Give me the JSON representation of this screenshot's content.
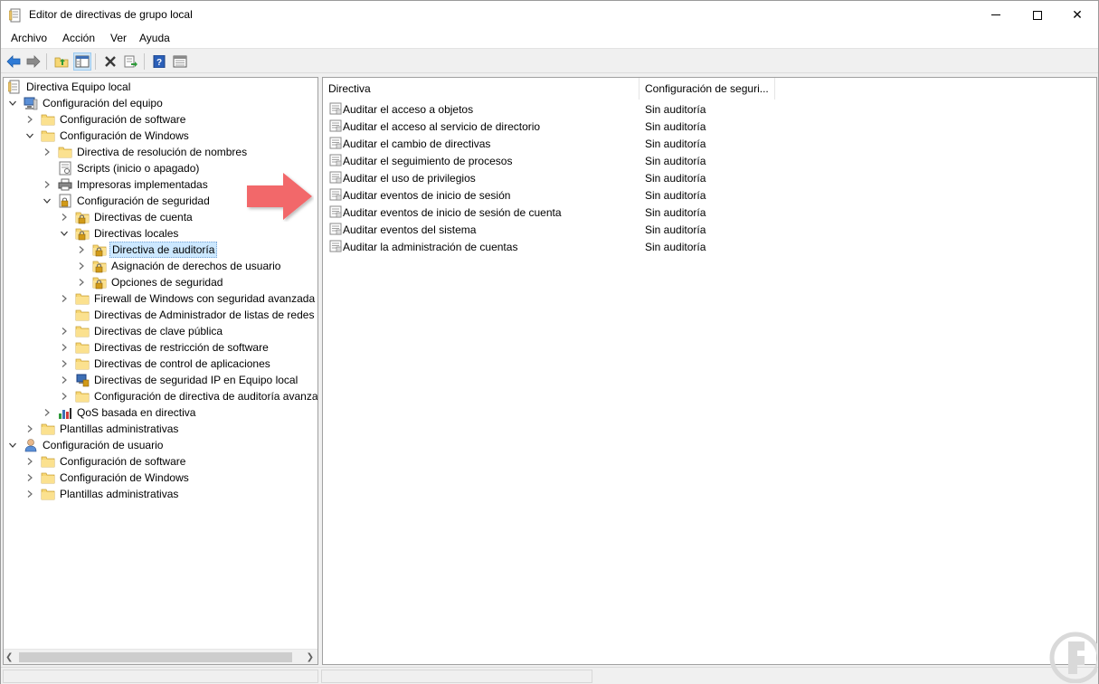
{
  "window": {
    "title": "Editor de directivas de grupo local",
    "minimize_glyph": "",
    "maximize_glyph": "",
    "close_glyph": "✕"
  },
  "menu": [
    "Archivo",
    "Acción",
    "Ver",
    "Ayuda"
  ],
  "tree": [
    {
      "label": "Directiva Equipo local",
      "level": 0,
      "expander": "none",
      "icon": "policy-doc-icon"
    },
    {
      "label": "Configuración del equipo",
      "level": 0,
      "expander": "open",
      "icon": "computer-icon"
    },
    {
      "label": "Configuración de software",
      "level": 1,
      "expander": "closed",
      "icon": "folder-icon"
    },
    {
      "label": "Configuración de Windows",
      "level": 1,
      "expander": "open",
      "icon": "folder-icon"
    },
    {
      "label": "Directiva de resolución de nombres",
      "level": 2,
      "expander": "closed",
      "icon": "folder-icon"
    },
    {
      "label": "Scripts (inicio o apagado)",
      "level": 2,
      "expander": "none",
      "icon": "script-icon"
    },
    {
      "label": "Impresoras implementadas",
      "level": 2,
      "expander": "closed",
      "icon": "printer-icon"
    },
    {
      "label": "Configuración de seguridad",
      "level": 2,
      "expander": "open",
      "icon": "security-icon"
    },
    {
      "label": "Directivas de cuenta",
      "level": 3,
      "expander": "closed",
      "icon": "lock-folder-icon"
    },
    {
      "label": "Directivas locales",
      "level": 3,
      "expander": "open",
      "icon": "lock-folder-icon"
    },
    {
      "label": "Directiva de auditoría",
      "level": 4,
      "expander": "closed",
      "icon": "lock-folder-icon",
      "selected": true
    },
    {
      "label": "Asignación de derechos de usuario",
      "level": 4,
      "expander": "closed",
      "icon": "lock-folder-icon"
    },
    {
      "label": "Opciones de seguridad",
      "level": 4,
      "expander": "closed",
      "icon": "lock-folder-icon"
    },
    {
      "label": "Firewall de Windows con seguridad avanzada",
      "level": 3,
      "expander": "closed",
      "icon": "folder-icon"
    },
    {
      "label": "Directivas de Administrador de listas de redes",
      "level": 3,
      "expander": "none",
      "icon": "folder-icon"
    },
    {
      "label": "Directivas de clave pública",
      "level": 3,
      "expander": "closed",
      "icon": "folder-icon"
    },
    {
      "label": "Directivas de restricción de software",
      "level": 3,
      "expander": "closed",
      "icon": "folder-icon"
    },
    {
      "label": "Directivas de control de aplicaciones",
      "level": 3,
      "expander": "closed",
      "icon": "folder-icon"
    },
    {
      "label": "Directivas de seguridad IP en Equipo local",
      "level": 3,
      "expander": "closed",
      "icon": "ip-security-icon"
    },
    {
      "label": "Configuración de directiva de auditoría avanza",
      "level": 3,
      "expander": "closed",
      "icon": "folder-icon"
    },
    {
      "label": "QoS basada en directiva",
      "level": 2,
      "expander": "closed",
      "icon": "qos-chart-icon"
    },
    {
      "label": "Plantillas administrativas",
      "level": 1,
      "expander": "closed",
      "icon": "folder-icon"
    },
    {
      "label": "Configuración de usuario",
      "level": 0,
      "expander": "open",
      "icon": "user-icon"
    },
    {
      "label": "Configuración de software",
      "level": 1,
      "expander": "closed",
      "icon": "folder-icon"
    },
    {
      "label": "Configuración de Windows",
      "level": 1,
      "expander": "closed",
      "icon": "folder-icon"
    },
    {
      "label": "Plantillas administrativas",
      "level": 1,
      "expander": "closed",
      "icon": "folder-icon"
    }
  ],
  "list": {
    "headers": [
      "Directiva",
      "Configuración de seguri..."
    ],
    "rows": [
      {
        "name": "Auditar el acceso a objetos",
        "value": "Sin auditoría"
      },
      {
        "name": "Auditar el acceso al servicio de directorio",
        "value": "Sin auditoría"
      },
      {
        "name": "Auditar el cambio de directivas",
        "value": "Sin auditoría"
      },
      {
        "name": "Auditar el seguimiento de procesos",
        "value": "Sin auditoría"
      },
      {
        "name": "Auditar el uso de privilegios",
        "value": "Sin auditoría"
      },
      {
        "name": "Auditar eventos de inicio de sesión",
        "value": "Sin auditoría"
      },
      {
        "name": "Auditar eventos de inicio de sesión de cuenta",
        "value": "Sin auditoría"
      },
      {
        "name": "Auditar eventos del sistema",
        "value": "Sin auditoría"
      },
      {
        "name": "Auditar la administración de cuentas",
        "value": "Sin auditoría"
      }
    ]
  },
  "colors": {
    "selection": "#cce8ff",
    "arrow": "#f2676b",
    "folder": "#f7d774",
    "accent_blue": "#1f6fc5"
  }
}
